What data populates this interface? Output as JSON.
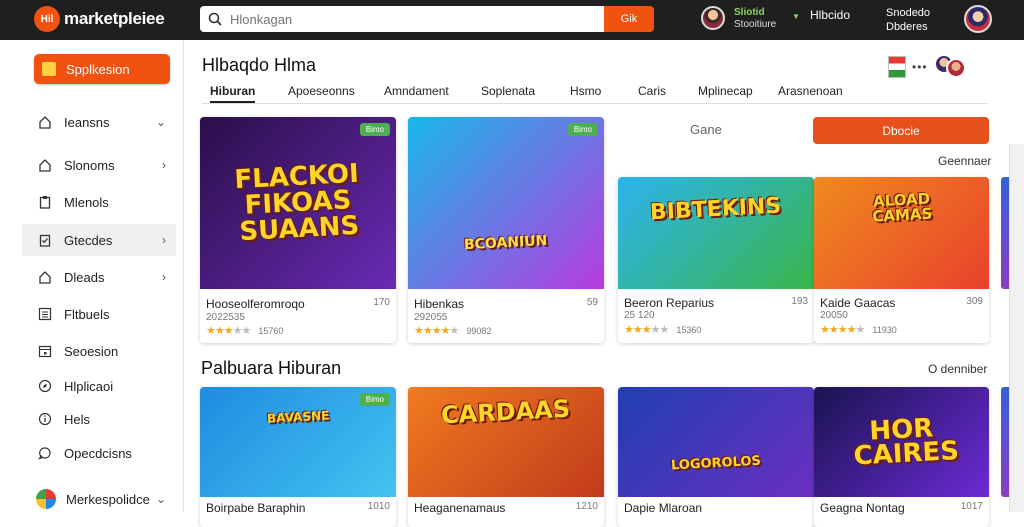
{
  "header": {
    "logo_badge": "Hil",
    "logo_text": "marketpleiee",
    "search_placeholder": "Hlonkagan",
    "search_button": "Gik",
    "account_name": "Sliotid",
    "account_sub": "Stooitiure",
    "account_link": "Hlbcido",
    "account2_line1": "Snodedo",
    "account2_line2": "Dbderes"
  },
  "sidebar": {
    "primary_button": "Spplkesion",
    "items": [
      {
        "label": "Ieansns",
        "icon": "home-icon",
        "chevron": true
      },
      {
        "label": "Slonoms",
        "icon": "home-icon",
        "chevron": true
      },
      {
        "label": "Mlenols",
        "icon": "clipboard-icon",
        "chevron": false
      },
      {
        "label": "Gtecdes",
        "icon": "clipboard-check-icon",
        "chevron": true
      },
      {
        "label": "Dleads",
        "icon": "home-icon",
        "chevron": true
      },
      {
        "label": "Fltbuels",
        "icon": "list-icon",
        "chevron": false
      },
      {
        "label": "Seoesion",
        "icon": "calendar-icon",
        "chevron": false
      },
      {
        "label": "Hlplicaoi",
        "icon": "compass-icon",
        "chevron": false
      },
      {
        "label": "Hels",
        "icon": "info-icon",
        "chevron": false
      },
      {
        "label": "Opecdcisns",
        "icon": "chat-icon",
        "chevron": false
      }
    ],
    "footer_label": "Merkespolidce"
  },
  "main": {
    "title": "Hlbaqdo Hlma",
    "tabs": [
      "Hiburan",
      "Apoeseonns",
      "Amndament",
      "Soplenata",
      "Hsmo",
      "Caris",
      "Mplinecap",
      "Arasnenoan"
    ],
    "active_tab": 0,
    "gane_label": "Gane",
    "discover_button": "Dbocie",
    "see_all_1": "Geennaer",
    "section2_title": "Palbuara Hiburan",
    "see_all_2": "O denniber"
  },
  "cards_row1": [
    {
      "art": "FLACKOI FIKOAS SUAANS",
      "badge": "Bimo",
      "name": "Hooseolferomroqo",
      "price": "170",
      "sub": "2022535",
      "stars": 3,
      "reviews": "15760",
      "colors": [
        "#2a0f4a",
        "#6a2ab5"
      ]
    },
    {
      "art": "BCOANIUN",
      "badge": "Bimo",
      "name": "Hibenkas",
      "price": "59",
      "sub": "292055",
      "stars": 4,
      "reviews": "99082",
      "colors": [
        "#19b8e8",
        "#b73be0"
      ]
    },
    {
      "art": "BIBTEKINS",
      "badge": "",
      "name": "Beeron Reparius",
      "price": "193",
      "sub": "25 120",
      "stars": 3,
      "reviews": "15360",
      "colors": [
        "#2db3ee",
        "#39b54a"
      ]
    },
    {
      "art": "ALOAD CAMAS",
      "badge": "",
      "name": "Kaide Gaacas",
      "price": "309",
      "sub": "20050",
      "stars": 4,
      "reviews": "11930",
      "colors": [
        "#f08a1f",
        "#e8412c"
      ]
    }
  ],
  "cards_row2": [
    {
      "art": "BAVASNE",
      "badge": "Bimo",
      "name": "Boirpabe Baraphin",
      "price": "1010",
      "colors": [
        "#1f8be0",
        "#44c3f0"
      ]
    },
    {
      "art": "CARDAAS",
      "badge": "",
      "name": "Heaganenamaus",
      "price": "1210",
      "colors": [
        "#f07b1f",
        "#c23a1c"
      ]
    },
    {
      "art": "LOGOROLOS",
      "badge": "",
      "name": "Dapie Mlaroan",
      "price": "",
      "colors": [
        "#213fb0",
        "#6b2fc0"
      ]
    },
    {
      "art": "HOR CAIRES",
      "badge": "",
      "name": "Geagna Nontag",
      "price": "1017",
      "colors": [
        "#1a1450",
        "#6c2ad6"
      ]
    }
  ]
}
